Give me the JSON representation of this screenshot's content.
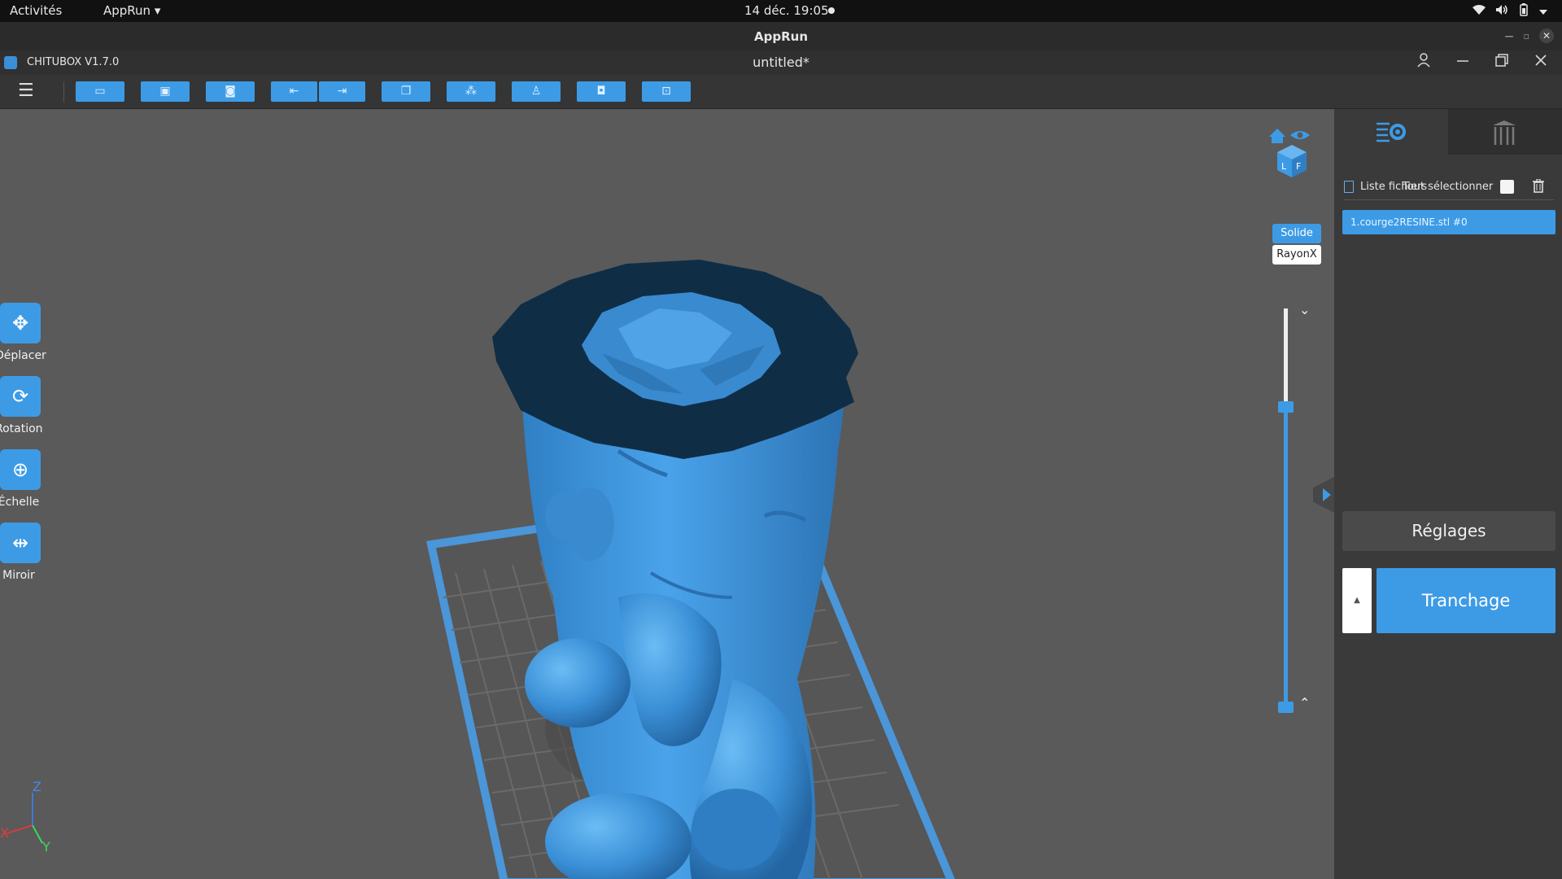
{
  "gnome": {
    "activities": "Activités",
    "app_menu": "AppRun ▾",
    "clock": "14 déc.  19:05"
  },
  "outer_window": {
    "title": "AppRun"
  },
  "app": {
    "name": "CHITUBOX V1.7.0",
    "document": "untitled*"
  },
  "toolbar": {
    "buttons": [
      "open-file",
      "save",
      "screenshot",
      "undo",
      "redo",
      "copy",
      "layout",
      "supports",
      "hollow",
      "export"
    ]
  },
  "left_tools": [
    {
      "label": "Déplacer",
      "icon": "move-icon"
    },
    {
      "label": "Rotation",
      "icon": "rotate-icon"
    },
    {
      "label": "Échelle",
      "icon": "scale-icon"
    },
    {
      "label": "Miroir",
      "icon": "mirror-icon"
    }
  ],
  "view_modes": {
    "solid": "Solide",
    "xray": "RayonX"
  },
  "axes": {
    "x": "X",
    "y": "Y",
    "z": "Z"
  },
  "panel": {
    "file_list_label": "Liste fichiers",
    "select_all_label": "Tout sélectionner",
    "files": [
      "1.courge2RESINE.stl #0"
    ],
    "settings_label": "Réglages",
    "slice_label": "Tranchage"
  },
  "colors": {
    "accent": "#3d9be6",
    "viewport": "#5a5a5a",
    "model": "#3f95dc",
    "model_dark": "#0f2e46"
  }
}
